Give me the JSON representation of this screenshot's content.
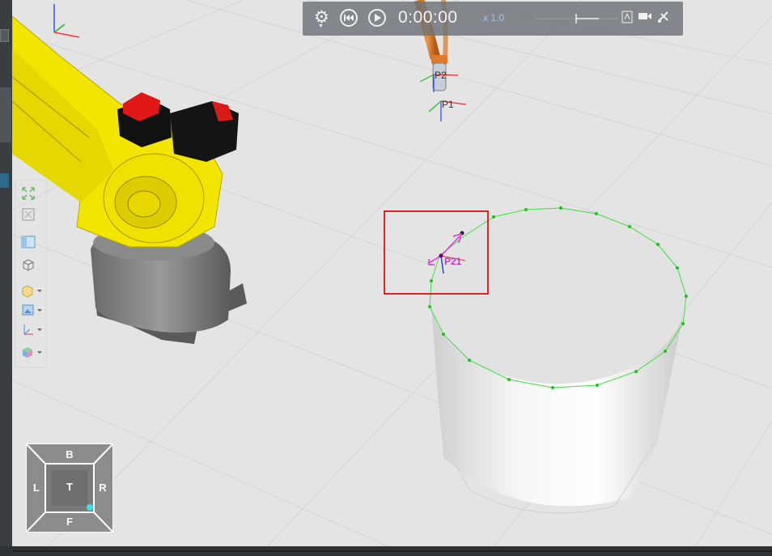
{
  "playback": {
    "time": "0:00:00",
    "speed": "x 1.0",
    "icons": [
      "gear-icon",
      "rewind-icon",
      "play-icon",
      "pdf-icon",
      "video-camera-icon",
      "satellite-icon"
    ]
  },
  "scene": {
    "frames": [
      {
        "label": "P2"
      },
      {
        "label": "P1"
      },
      {
        "label": "P21"
      }
    ],
    "highlight_color": "#e02424",
    "path_color": "#2ad92a",
    "robot_color": "#f2e600"
  },
  "view_toolbar": {
    "items": [
      "fit-view-icon",
      "fullscreen-icon",
      "layout-icon",
      "cube-outline-icon",
      "box-shading-icon",
      "image-icon",
      "axes-icon",
      "color-cube-icon"
    ]
  },
  "view_cube": {
    "top": "B",
    "left": "L",
    "center": "T",
    "right": "R",
    "bottom": "F"
  }
}
